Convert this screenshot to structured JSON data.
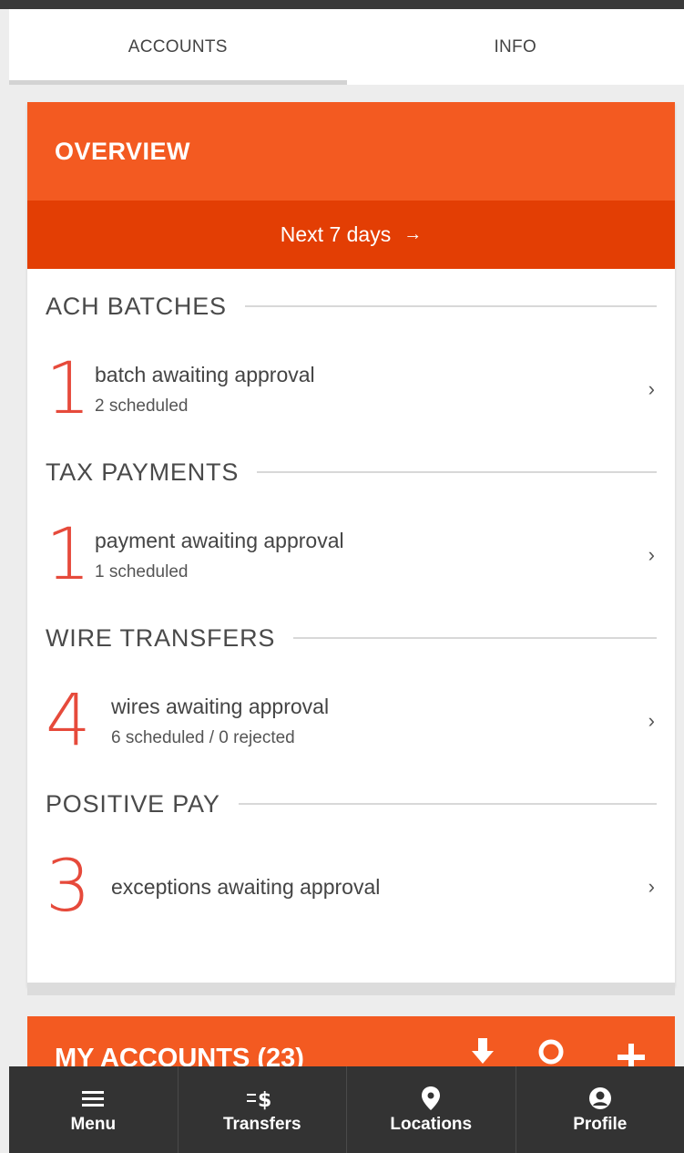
{
  "tabs": [
    {
      "label": "ACCOUNTS",
      "active": true
    },
    {
      "label": "INFO",
      "active": false
    }
  ],
  "overview": {
    "title": "OVERVIEW",
    "range_label": "Next 7 days",
    "range_arrow": "→"
  },
  "sections": [
    {
      "title": "ACH BATCHES",
      "count": "1",
      "main": "batch awaiting approval",
      "sub": "2 scheduled"
    },
    {
      "title": "TAX PAYMENTS",
      "count": "1",
      "main": "payment awaiting approval",
      "sub": "1 scheduled"
    },
    {
      "title": "WIRE TRANSFERS",
      "count": "4",
      "main": "wires awaiting approval",
      "sub": "6 scheduled / 0 rejected"
    },
    {
      "title": "POSITIVE PAY",
      "count": "3",
      "main": "exceptions awaiting approval",
      "sub": ""
    }
  ],
  "chevron": "›",
  "my_accounts": {
    "title": "MY ACCOUNTS (23)"
  },
  "bottom_nav": [
    {
      "label": "Menu",
      "icon": "menu-icon"
    },
    {
      "label": "Transfers",
      "icon": "transfers-icon"
    },
    {
      "label": "Locations",
      "icon": "location-pin-icon"
    },
    {
      "label": "Profile",
      "icon": "profile-icon"
    }
  ],
  "colors": {
    "accent": "#f35a21",
    "accent_dark": "#e33e04",
    "number_red": "#e64a3b",
    "nav_bg": "#333333"
  }
}
